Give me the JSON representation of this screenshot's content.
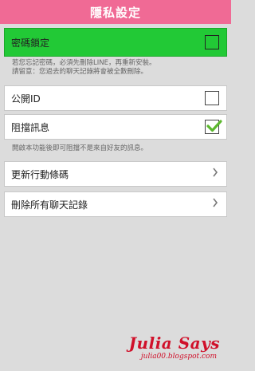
{
  "header": {
    "title": "隱私設定"
  },
  "passcode": {
    "label": "密碼鎖定",
    "checked": false
  },
  "passcode_note": {
    "line1": "若您忘記密碼，必須先刪除LINE，再重新安裝。",
    "line2": "請留意：您過去的聊天記錄將會被全數刪除。"
  },
  "public_id": {
    "label": "公開ID",
    "checked": false
  },
  "block_messages": {
    "label": "阻擋訊息",
    "checked": true
  },
  "block_note": "開啟本功能後即可阻擋不是來自好友的訊息。",
  "update_mobile_code": {
    "label": "更新行動條碼"
  },
  "delete_all_chats": {
    "label": "刪除所有聊天記錄"
  },
  "watermark": {
    "title": "Julia Says",
    "url": "julia00.blogspot.com"
  },
  "colors": {
    "header": "#f06a95",
    "highlight": "#22c936",
    "check": "#5cb82e",
    "watermark": "#d0102a"
  },
  "icons": {
    "chevron": "chevron-right-icon",
    "check": "checkmark-icon"
  }
}
